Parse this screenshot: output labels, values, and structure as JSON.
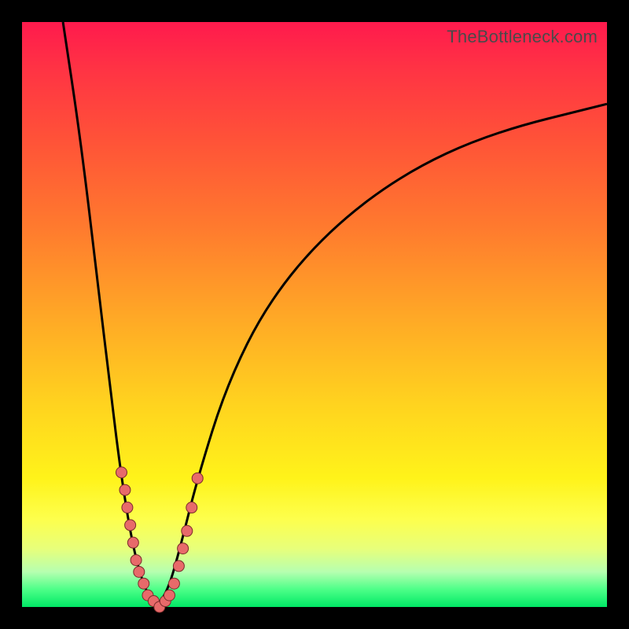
{
  "watermark": "TheBottleneck.com",
  "colors": {
    "frame": "#000000",
    "curve": "#000000",
    "dot_fill": "#e86a6a",
    "dot_stroke": "#7a2b2b",
    "gradient_stops": [
      "#ff1a4d",
      "#ff3344",
      "#ff5238",
      "#ff7a2e",
      "#ffa726",
      "#ffd21f",
      "#fff31a",
      "#fdff4d",
      "#e8ff7a",
      "#b6ffb0",
      "#4dff88",
      "#00e865"
    ]
  },
  "chart_data": {
    "type": "line",
    "title": "",
    "xlabel": "",
    "ylabel": "",
    "xlim": [
      0,
      100
    ],
    "ylim": [
      0,
      100
    ],
    "series": [
      {
        "name": "bottleneck-curve",
        "points": [
          {
            "x": 7,
            "y": 100
          },
          {
            "x": 10,
            "y": 80
          },
          {
            "x": 13,
            "y": 55
          },
          {
            "x": 15,
            "y": 38
          },
          {
            "x": 17,
            "y": 22
          },
          {
            "x": 19,
            "y": 10
          },
          {
            "x": 21,
            "y": 3
          },
          {
            "x": 23,
            "y": 0
          },
          {
            "x": 25,
            "y": 3
          },
          {
            "x": 27,
            "y": 10
          },
          {
            "x": 30,
            "y": 22
          },
          {
            "x": 35,
            "y": 38
          },
          {
            "x": 42,
            "y": 52
          },
          {
            "x": 52,
            "y": 64
          },
          {
            "x": 65,
            "y": 74
          },
          {
            "x": 80,
            "y": 81
          },
          {
            "x": 100,
            "y": 86
          }
        ]
      }
    ],
    "scatter_points": [
      {
        "x": 17.0,
        "y": 23
      },
      {
        "x": 17.6,
        "y": 20
      },
      {
        "x": 18.0,
        "y": 17
      },
      {
        "x": 18.5,
        "y": 14
      },
      {
        "x": 19.0,
        "y": 11
      },
      {
        "x": 19.5,
        "y": 8
      },
      {
        "x": 20.0,
        "y": 6
      },
      {
        "x": 20.8,
        "y": 4
      },
      {
        "x": 21.5,
        "y": 2
      },
      {
        "x": 22.5,
        "y": 1
      },
      {
        "x": 23.5,
        "y": 0
      },
      {
        "x": 24.5,
        "y": 1
      },
      {
        "x": 25.2,
        "y": 2
      },
      {
        "x": 26.0,
        "y": 4
      },
      {
        "x": 26.8,
        "y": 7
      },
      {
        "x": 27.5,
        "y": 10
      },
      {
        "x": 28.2,
        "y": 13
      },
      {
        "x": 29.0,
        "y": 17
      },
      {
        "x": 30.0,
        "y": 22
      }
    ]
  }
}
